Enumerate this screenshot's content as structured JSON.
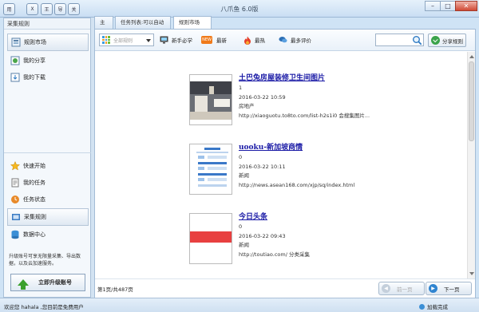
{
  "titlebar": {
    "app_title": "八爪鱼 6.0版",
    "quick_buttons": [
      "用",
      "X",
      "王",
      "导",
      "关"
    ],
    "min": "–",
    "max": "□",
    "close": "✕"
  },
  "sidebar": {
    "header": "采集规则",
    "top_items": [
      {
        "label": "规则市场",
        "icon": "market-icon"
      },
      {
        "label": "我的分享",
        "icon": "share-icon"
      },
      {
        "label": "我的下载",
        "icon": "download-icon"
      }
    ],
    "bottom_items": [
      {
        "label": "快速开始",
        "icon": "star-icon"
      },
      {
        "label": "我的任务",
        "icon": "task-icon"
      },
      {
        "label": "任务状态",
        "icon": "status-icon"
      },
      {
        "label": "采集规则",
        "icon": "rules-icon"
      },
      {
        "label": "数据中心",
        "icon": "database-icon"
      }
    ],
    "tip": "升级账号可享无限量采集、导出数据，以及云加速服务。",
    "upgrade_label": "立即升级账号"
  },
  "tabs": [
    {
      "label": "主页"
    },
    {
      "label": "任务列表:可以自动"
    },
    {
      "label": "规则市场",
      "close": "×"
    }
  ],
  "toolbar": {
    "category_placeholder": "全部规则",
    "newbie": "新手必学",
    "newest": "最新",
    "hottest": "最热",
    "most_reviewed": "最多评价",
    "new_badge": "NEW",
    "share_label": "分享规则"
  },
  "items": [
    {
      "title": "土巴兔房屋装修卫生间图片",
      "count": "1",
      "date": "2016-03-22 10:59",
      "category": "房地产",
      "url": "http://xiaoguotu.to8to.com/list-h2s1i0  会搜集图片..."
    },
    {
      "title": "uooku-新加坡商情",
      "count": "0",
      "date": "2016-03-22 10:11",
      "category": "新闻",
      "url": "http://news.asean168.com/xjp/sq/index.html"
    },
    {
      "title": "今日头条",
      "count": "0",
      "date": "2016-03-22 09:43",
      "category": "新闻",
      "url": "http://toutiao.com/   分类采集"
    }
  ],
  "pager": {
    "info": "第1页/共487页",
    "prev": "前一页",
    "next": "下一页"
  },
  "status": {
    "text": "欢迎您  hahala ,您目前是免费用户",
    "right": "加载完成"
  }
}
